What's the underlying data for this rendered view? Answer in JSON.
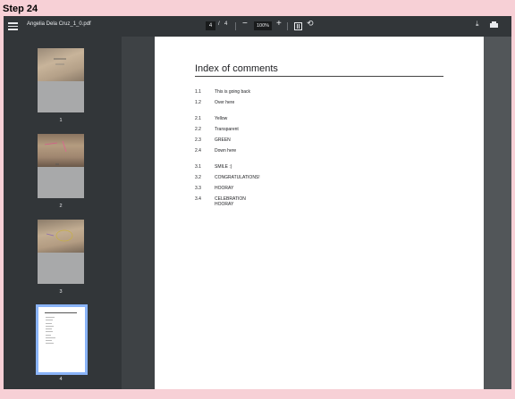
{
  "step": {
    "label": "Step 24"
  },
  "toolbar": {
    "title": "Angelia Dela Cruz_1_0.pdf",
    "current_page": "4",
    "page_separator": "/",
    "total_pages": "4",
    "zoom_out": "−",
    "zoom_level": "100%",
    "zoom_in": "+",
    "rotate": "⟲",
    "download": "⤓"
  },
  "thumbnails": [
    {
      "number": "1"
    },
    {
      "number": "2"
    },
    {
      "number": "3"
    },
    {
      "number": "4"
    }
  ],
  "document": {
    "heading": "Index of comments",
    "entries": [
      {
        "num": "1.1",
        "text": "This is going back"
      },
      {
        "num": "1.2",
        "text": "Over here"
      },
      {
        "num": "2.1",
        "text": "Yellow"
      },
      {
        "num": "2.2",
        "text": "Transparent"
      },
      {
        "num": "2.3",
        "text": "GREEN"
      },
      {
        "num": "2.4",
        "text": "Down here"
      },
      {
        "num": "3.1",
        "text": "SMILE :)"
      },
      {
        "num": "3.2",
        "text": "CONGRATULATIONS!"
      },
      {
        "num": "3.3",
        "text": "HOORAY"
      },
      {
        "num": "3.4",
        "text": "CELEBRATION\nHOORAY"
      }
    ]
  },
  "colors": {
    "background": "#f7d0d6",
    "toolbar": "#323639",
    "viewer": "#525659",
    "selected_thumb_border": "#8ab4f8"
  }
}
